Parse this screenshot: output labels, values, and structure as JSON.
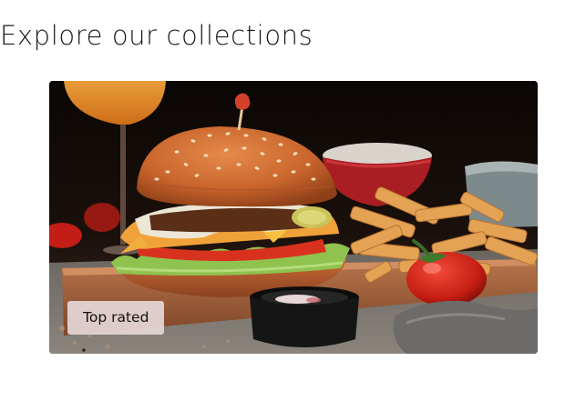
{
  "section": {
    "title": "Explore our collections"
  },
  "collection_card": {
    "image_subject": "burger-with-fries",
    "badge_label": "Top rated"
  }
}
